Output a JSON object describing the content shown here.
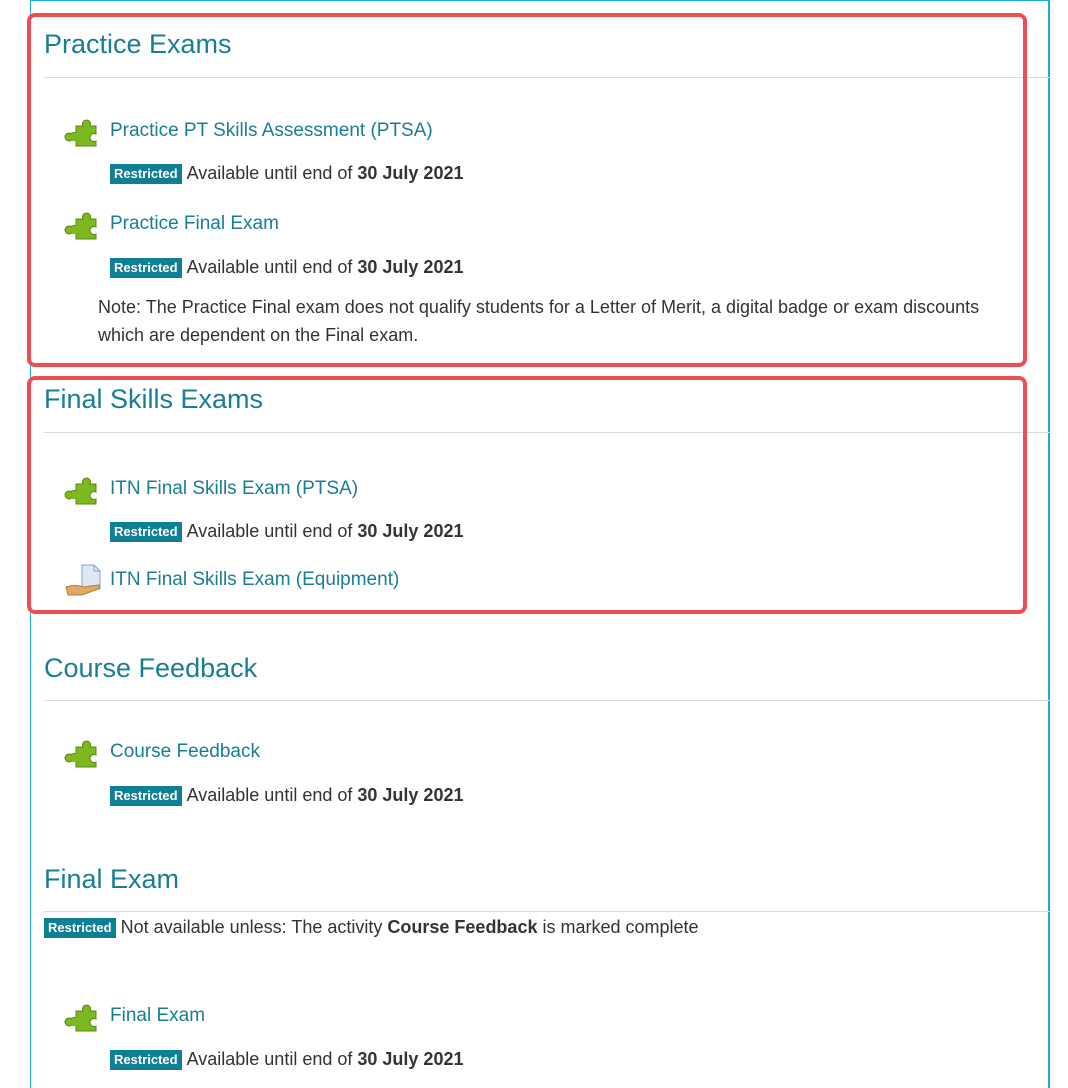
{
  "colors": {
    "accent": "#1a7d96",
    "badge": "#0f7f93",
    "highlight": "#ef4d55",
    "panel_border": "#1fa9d6"
  },
  "sections": {
    "practice": {
      "title": "Practice Exams",
      "items": [
        {
          "label": "Practice PT Skills Assessment (PTSA)",
          "icon": "puzzle-icon",
          "badge": "Restricted",
          "availability": "Available until end of",
          "date": "30 July 2021"
        },
        {
          "label": "Practice Final Exam",
          "icon": "puzzle-icon",
          "badge": "Restricted",
          "availability": "Available until end of",
          "date": "30 July 2021"
        }
      ],
      "note": "Note: The Practice Final exam does not qualify students for a Letter of Merit, a digital badge or exam discounts which are dependent on the Final exam."
    },
    "final_skills": {
      "title": "Final Skills Exams",
      "items": [
        {
          "label": "ITN Final Skills Exam (PTSA)",
          "icon": "puzzle-icon",
          "badge": "Restricted",
          "availability": "Available until end of",
          "date": "30 July 2021"
        },
        {
          "label": "ITN Final Skills Exam (Equipment)",
          "icon": "assignment-icon"
        }
      ]
    },
    "feedback": {
      "title": "Course Feedback",
      "items": [
        {
          "label": "Course Feedback",
          "icon": "puzzle-icon",
          "badge": "Restricted",
          "availability": "Available until end of",
          "date": "30 July 2021"
        }
      ]
    },
    "final_exam": {
      "title": "Final Exam",
      "restriction": {
        "badge": "Restricted",
        "prefix": "Not available unless: The activity",
        "activity": "Course Feedback",
        "suffix": "is marked complete"
      },
      "items": [
        {
          "label": "Final Exam",
          "icon": "puzzle-icon",
          "badge": "Restricted",
          "availability": "Available until end of",
          "date": "30 July 2021"
        }
      ]
    }
  }
}
